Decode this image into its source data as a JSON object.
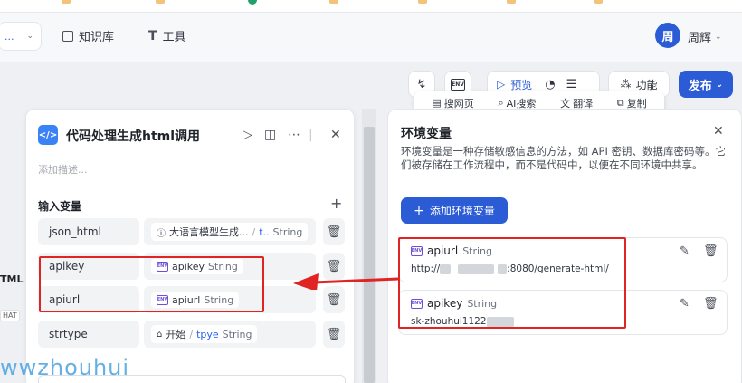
{
  "header": {
    "workspace_suffix": "...",
    "nav": [
      {
        "label": "知识库",
        "icon": "book-icon"
      },
      {
        "label": "工具",
        "icon": "tool-icon"
      }
    ],
    "avatar_text": "周",
    "user_name": "周辉"
  },
  "toolbar": {
    "env_badge": "ENV",
    "preview_label": "预览",
    "function_label": "功能",
    "publish_label": "发布"
  },
  "quickbar": {
    "items": [
      {
        "label": "搜网页",
        "icon": "document-icon"
      },
      {
        "label": "AI搜索",
        "icon": "search-icon"
      },
      {
        "label": "翻译",
        "icon": "translate-icon"
      },
      {
        "label": "复制",
        "icon": "copy-icon"
      }
    ]
  },
  "canvas_fragment": {
    "label": "TML",
    "chip": "HAT"
  },
  "node": {
    "icon_text": "</>",
    "title": "代码处理生成html调用",
    "description_placeholder": "添加描述...",
    "section_title": "输入变量",
    "vars": [
      {
        "name": "json_html",
        "source": "大语言模型生成...",
        "sep": "/",
        "ref": "t..",
        "type": "String"
      },
      {
        "name": "apikey",
        "ref": "apikey",
        "type": "String"
      },
      {
        "name": "apiurl",
        "ref": "apiurl",
        "type": "String"
      },
      {
        "name": "strtype",
        "source": "开始",
        "sep": "/",
        "ref": "tpye",
        "type": "String"
      }
    ]
  },
  "env_panel": {
    "title": "环境变量",
    "description": "环境变量是一种存储敏感信息的方法，如 API 密钥、数据库密码等。它们被存储在工作流程中，而不是代码中，以便在不同环境中共享。",
    "add_button": "添加环境变量",
    "cards": [
      {
        "name": "apiurl",
        "type": "String",
        "value_prefix": "http://",
        "value_suffix": ":8080/generate-html/"
      },
      {
        "name": "apikey",
        "type": "String",
        "value_prefix": "sk-zhouhui1122",
        "value_suffix": ""
      }
    ]
  },
  "watermark": "wwzhouhui",
  "colors": {
    "accent": "#2b5cd6",
    "annotation": "#e02424",
    "env_icon": "#6d4fd6"
  }
}
